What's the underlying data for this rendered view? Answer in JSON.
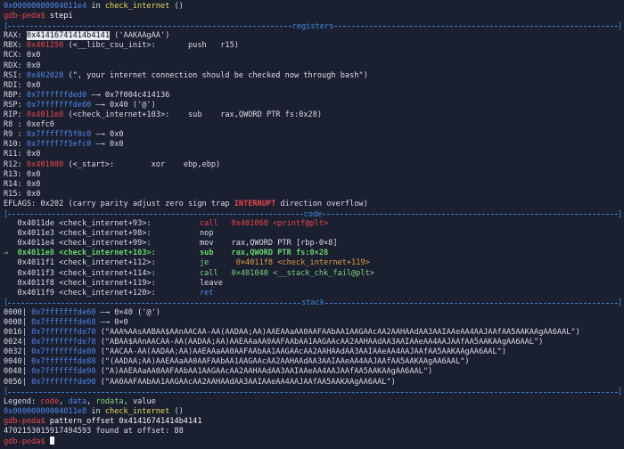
{
  "header": {
    "addr": "0x00000000004011e4",
    "in_text": " in ",
    "func": "check_internet",
    "parens": " ()"
  },
  "prompt1": {
    "name": "gdb-peda",
    "sign": "$ ",
    "cmd": "stepi"
  },
  "sections": {
    "registers": "registers",
    "code": "code",
    "stack": "stack"
  },
  "registers": {
    "rax": {
      "name": "RAX",
      "val": "0x41416741414b4141",
      "rest": " ('AAKAAgAA')"
    },
    "rbx": {
      "name": "RBX",
      "val": "0x401250",
      "sym": " (<__libc_csu_init>:",
      "ins": "       push   r15)"
    },
    "rcx": {
      "name": "RCX",
      "val": "0x0"
    },
    "rdx": {
      "name": "RDX",
      "val": "0x0"
    },
    "rsi": {
      "name": "RSI",
      "val": "0x402028",
      "rest": " (\", your internet connection should be checked now through bash\")"
    },
    "rdi": {
      "name": "RDI",
      "val": "0x0"
    },
    "rbp": {
      "name": "RBP",
      "val": "0x7ffffffded0",
      "arrow": " —→ ",
      "rest": "0x7f004c414136"
    },
    "rsp": {
      "name": "RSP",
      "val": "0x7fffffffde60",
      "arrow": " —→ ",
      "rest": "0x40 ('@')"
    },
    "rip": {
      "name": "RIP",
      "val": "0x4011e8",
      "sym": " (<check_internet+103>:",
      "ins": "    sub    rax,QWORD PTR fs:0x28)"
    },
    "r8": {
      "name": "R8 ",
      "val": "0xefc0"
    },
    "r9": {
      "name": "R9 ",
      "val": "0x7ffff7f5f0c0",
      "arrow": " —→ ",
      "rest": "0x0"
    },
    "r10": {
      "name": "R10",
      "val": "0x7ffff7f5efc0",
      "arrow": " —→ ",
      "rest": "0x0"
    },
    "r11": {
      "name": "R11",
      "val": "0x0"
    },
    "r12": {
      "name": "R12",
      "val": "0x401080",
      "sym": " (<_start>:",
      "ins": "        xor    ebp,ebp)"
    },
    "r13": {
      "name": "R13",
      "val": "0x0"
    },
    "r14": {
      "name": "R14",
      "val": "0x0"
    },
    "r15": {
      "name": "R15",
      "val": "0x0"
    },
    "eflags": {
      "name": "EFLAGS",
      "val": ": 0x202 ",
      "pre": "(carry parity adjust zero sign trap ",
      "int": "INTERRUPT",
      "post": " direction overflow)"
    }
  },
  "code": [
    {
      "marker": "   ",
      "addr": "0x4011de",
      "sym": " <check_internet+93>:",
      "op": "call",
      "args": "   0x401060 <printf@plt>",
      "opcolor": "red",
      "argcolor": "red"
    },
    {
      "marker": "   ",
      "addr": "0x4011e3",
      "sym": " <check_internet+98>:",
      "op": "nop",
      "args": "",
      "opcolor": "normal",
      "argcolor": "normal"
    },
    {
      "marker": "   ",
      "addr": "0x4011e4",
      "sym": " <check_internet+99>:",
      "op": "mov",
      "args": "   rax,QWORD PTR [rbp-0×8]",
      "opcolor": "normal",
      "argcolor": "normal"
    },
    {
      "marker": "⇒  ",
      "addr": "0x4011e8",
      "sym": " <check_internet+103>:",
      "op": "sub",
      "args": "   rax,QWORD PTR fs:0×28",
      "opcolor": "cur",
      "argcolor": "cur"
    },
    {
      "marker": "   ",
      "addr": "0x4011f1",
      "sym": " <check_internet+112>:",
      "op": "je",
      "args": "    0×4011f8 <check_internet+119>",
      "opcolor": "green",
      "argcolor": "orange"
    },
    {
      "marker": "   ",
      "addr": "0x4011f3",
      "sym": " <check_internet+114>:",
      "op": "call",
      "args": "   0×401040 <__stack_chk_fail@plt>",
      "opcolor": "green",
      "argcolor": "green"
    },
    {
      "marker": "   ",
      "addr": "0x4011f8",
      "sym": " <check_internet+119>:",
      "op": "leave",
      "args": "",
      "opcolor": "normal",
      "argcolor": "normal"
    },
    {
      "marker": "   ",
      "addr": "0x4011f9",
      "sym": " <check_internet+120>:",
      "op": "ret",
      "args": "",
      "opcolor": "blue",
      "argcolor": "normal"
    }
  ],
  "stack": [
    {
      "off": "0000",
      "addr": "0x7fffffffde60",
      "arrow": " —→ ",
      "val": "0×40 ('@')"
    },
    {
      "off": "0008",
      "addr": "0x7fffffffde68",
      "arrow": " —→ ",
      "val": "0×0"
    },
    {
      "off": "0016",
      "addr": "0x7fffffffde70",
      "arrow": " ",
      "val": "(\"AAA%AAsAABAA$AAnAACAA-AA(AADAA;AA)AAEAAaAA0AAFAAbAA1AAGAAcAA2AAHAAdAA3AAIAAeAA4AAJAAfAA5AAKAAgAA6AAL\")"
    },
    {
      "off": "0024",
      "addr": "0x7fffffffde78",
      "arrow": " ",
      "val": "(\"ABAA$AAnAACAA-AA(AADAA;AA)AAEAAaAA0AAFAAbAA1AAGAAcAA2AAHAAdAA3AAIAAeAA4AAJAAfAA5AAKAAgAA6AAL\")"
    },
    {
      "off": "0032",
      "addr": "0x7fffffffde80",
      "arrow": " ",
      "val": "(\"AACAA-AA(AADAA;AA)AAEAAaAA0AAFAAbAA1AAGAAcAA2AAHAAdAA3AAIAAeAA4AAJAAfAA5AAKAAgAA6AAL\")"
    },
    {
      "off": "0040",
      "addr": "0x7fffffffde88",
      "arrow": " ",
      "val": "(\"(AADAA;AA)AAEAAaAA0AAFAAbAA1AAGAAcAA2AAHAAdAA3AAIAAeAA4AAJAAfAA5AAKAAgAA6AAL\")"
    },
    {
      "off": "0048",
      "addr": "0x7fffffffde90",
      "arrow": " ",
      "val": "(\"A)AAEAAaAA0AAFAAbAA1AAGAAcAA2AAHAAdAA3AAIAAeAA4AAJAAfAA5AAKAAgAA6AAL\")"
    },
    {
      "off": "0056",
      "addr": "0x7fffffffde98",
      "arrow": " ",
      "val": "(\"AA0AAFAAbAA1AAGAAcAA2AAHAAdAA3AAIAAeAA4AAJAAfAA5AAKAAgAA6AAL\")"
    }
  ],
  "legend": {
    "label": "Legend: ",
    "code": "code",
    "c1": ", ",
    "data": "data",
    "c2": ", ",
    "rodata": "rodata",
    "c3": ", ",
    "value": "value"
  },
  "header2": {
    "addr": "0x00000000004011e8",
    "in_text": " in ",
    "func": "check_internet",
    "parens": " ()"
  },
  "prompt2": {
    "name": "gdb-peda",
    "sign": "$ ",
    "cmd": "pattern_offset 0x41416741414b4141"
  },
  "result": "4702153015917494593 found at offset: 88",
  "prompt3": {
    "name": "gdb-peda",
    "sign": "$ "
  }
}
